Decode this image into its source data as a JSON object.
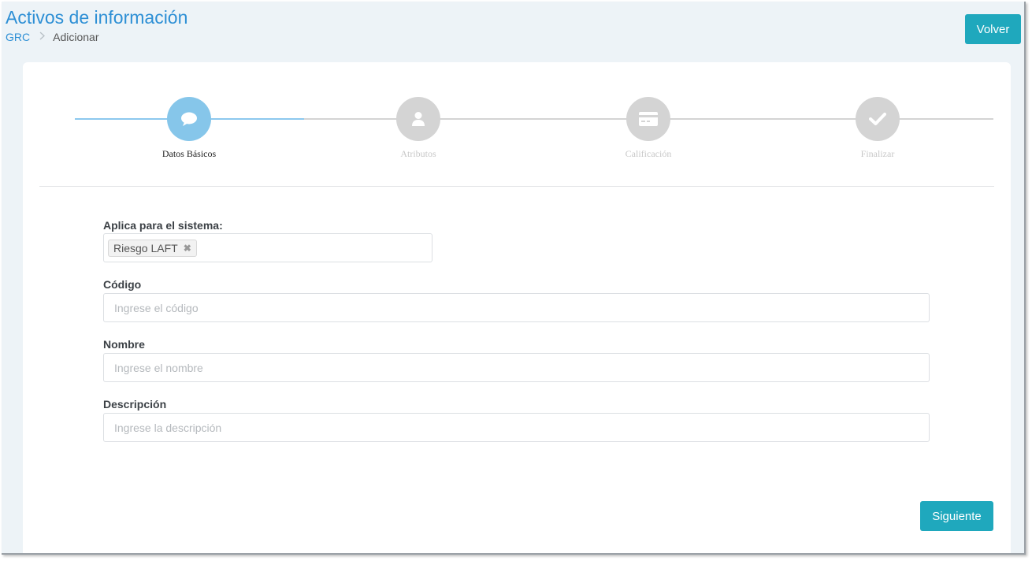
{
  "header": {
    "title": "Activos de información",
    "breadcrumb": {
      "root": "GRC",
      "current": "Adicionar"
    },
    "back_label": "Volver"
  },
  "stepper": {
    "steps": [
      {
        "label": "Datos Básicos",
        "icon": "chat-bubble-icon",
        "state": "active"
      },
      {
        "label": "Atributos",
        "icon": "user-icon",
        "state": "inactive"
      },
      {
        "label": "Calificación",
        "icon": "credit-card-icon",
        "state": "inactive"
      },
      {
        "label": "Finalizar",
        "icon": "check-icon",
        "state": "inactive"
      }
    ]
  },
  "form": {
    "system": {
      "label": "Aplica para el sistema:",
      "tags": [
        "Riesgo LAFT"
      ],
      "remove_symbol": "✖"
    },
    "code": {
      "label": "Código",
      "placeholder": "Ingrese el código",
      "value": ""
    },
    "name": {
      "label": "Nombre",
      "placeholder": "Ingrese el nombre",
      "value": ""
    },
    "description": {
      "label": "Descripción",
      "placeholder": "Ingrese la descripción",
      "value": ""
    },
    "next_label": "Siguiente"
  },
  "colors": {
    "accent": "#1fa8bd",
    "title_blue": "#2d8fd5",
    "step_active": "#86c6ea",
    "step_inactive": "#d4d4d4",
    "background": "#edf3f7"
  }
}
